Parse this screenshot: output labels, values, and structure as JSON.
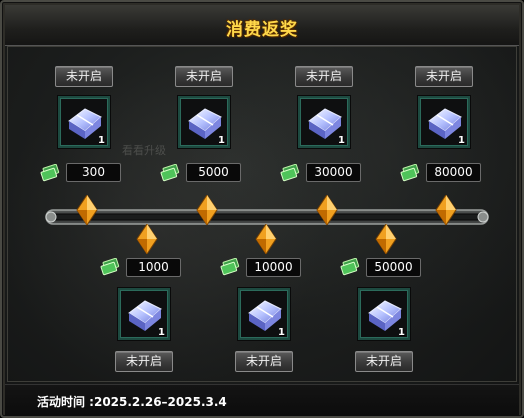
{
  "title": "消费返奖",
  "ghost_text": "看看升级",
  "status_label": "未开启",
  "top_tiers": [
    {
      "amount": "300",
      "qty": "1",
      "status": "未开启"
    },
    {
      "amount": "5000",
      "qty": "1",
      "status": "未开启"
    },
    {
      "amount": "30000",
      "qty": "1",
      "status": "未开启"
    },
    {
      "amount": "80000",
      "qty": "1",
      "status": "未开启"
    }
  ],
  "bottom_tiers": [
    {
      "amount": "1000",
      "qty": "1",
      "status": "未开启"
    },
    {
      "amount": "10000",
      "qty": "1",
      "status": "未开启"
    },
    {
      "amount": "50000",
      "qty": "1",
      "status": "未开启"
    }
  ],
  "footer": {
    "activity_time": "活动时间 :2025.2.26–2025.3.4"
  },
  "icons": {
    "reward": "item-box-icon",
    "currency": "money-icon",
    "marker": "gem-marker-icon"
  },
  "colors": {
    "title": "#ffd84a",
    "slot_border": "#2b6a5b",
    "gem": "#f0a020"
  }
}
